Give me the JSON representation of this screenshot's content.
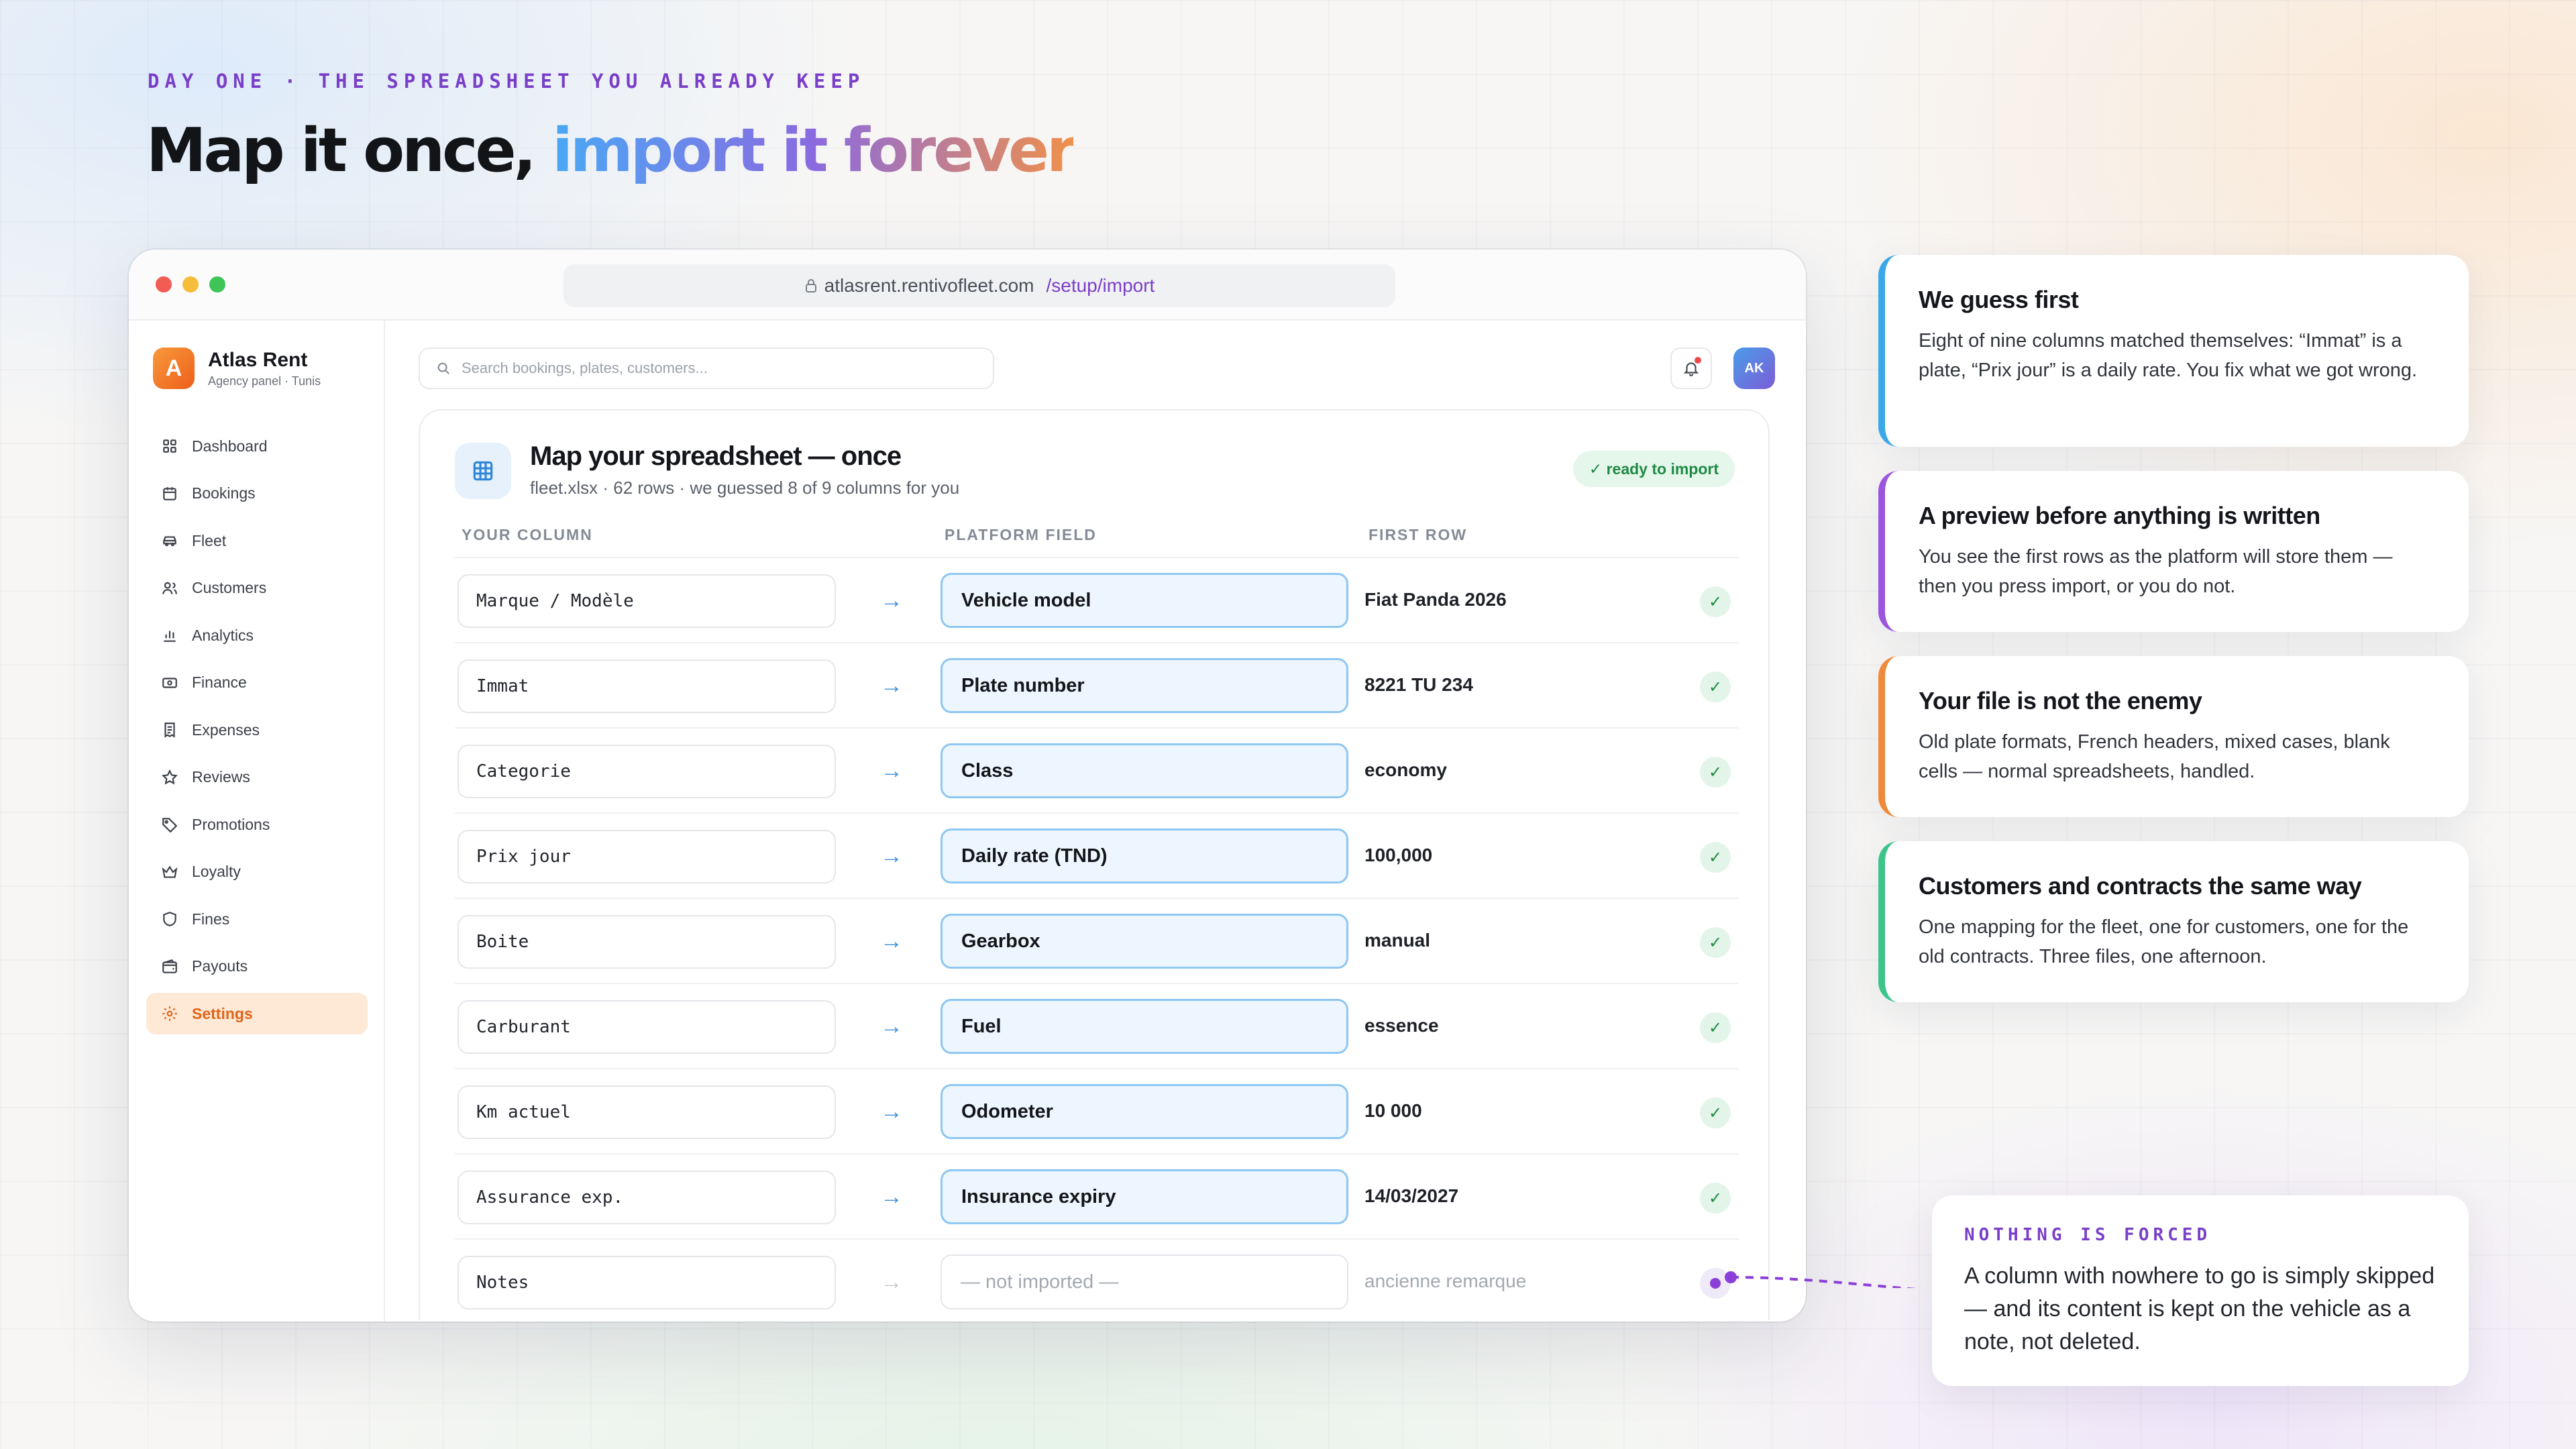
{
  "page": {
    "eyebrow": "DAY ONE · THE SPREADSHEET YOU ALREADY KEEP",
    "headline_plain": "Map it once, ",
    "headline_accent": "import it forever"
  },
  "browser": {
    "url_host": "atlasrent.rentivofleet.com",
    "url_path": "/setup/import",
    "lock_icon": "lock-icon"
  },
  "sidebar": {
    "brand_letter": "A",
    "brand_name": "Atlas Rent",
    "brand_sub": "Agency panel · Tunis",
    "items": [
      {
        "label": "Dashboard",
        "icon": "grid-icon"
      },
      {
        "label": "Bookings",
        "icon": "calendar-icon"
      },
      {
        "label": "Fleet",
        "icon": "car-icon"
      },
      {
        "label": "Customers",
        "icon": "users-icon"
      },
      {
        "label": "Analytics",
        "icon": "bar-chart-icon"
      },
      {
        "label": "Finance",
        "icon": "banknote-icon"
      },
      {
        "label": "Expenses",
        "icon": "receipt-icon"
      },
      {
        "label": "Reviews",
        "icon": "star-icon"
      },
      {
        "label": "Promotions",
        "icon": "tag-icon"
      },
      {
        "label": "Loyalty",
        "icon": "crown-icon"
      },
      {
        "label": "Fines",
        "icon": "shield-icon"
      },
      {
        "label": "Payouts",
        "icon": "wallet-icon"
      },
      {
        "label": "Settings",
        "icon": "gear-icon",
        "active": true
      }
    ]
  },
  "topbar": {
    "search_placeholder": "Search bookings, plates, customers...",
    "avatar_initials": "AK"
  },
  "mapping": {
    "title": "Map your spreadsheet — once",
    "subtitle": "fleet.xlsx · 62 rows · we guessed 8 of 9 columns for you",
    "status_badge": "✓ ready to import",
    "columns": [
      "YOUR COLUMN",
      "PLATFORM FIELD",
      "FIRST ROW"
    ],
    "rows": [
      {
        "source": "Marque / Modèle",
        "field": "Vehicle model",
        "first": "Fiat Panda 2026",
        "mapped": true
      },
      {
        "source": "Immat",
        "field": "Plate number",
        "first": "8221 TU 234",
        "mapped": true
      },
      {
        "source": "Categorie",
        "field": "Class",
        "first": "economy",
        "mapped": true
      },
      {
        "source": "Prix jour",
        "field": "Daily rate (TND)",
        "first": "100,000",
        "mapped": true
      },
      {
        "source": "Boite",
        "field": "Gearbox",
        "first": "manual",
        "mapped": true
      },
      {
        "source": "Carburant",
        "field": "Fuel",
        "first": "essence",
        "mapped": true
      },
      {
        "source": "Km actuel",
        "field": "Odometer",
        "first": "10 000",
        "mapped": true
      },
      {
        "source": "Assurance exp.",
        "field": "Insurance expiry",
        "first": "14/03/2027",
        "mapped": true
      },
      {
        "source": "Notes",
        "field": "— not imported —",
        "first": "ancienne remarque",
        "mapped": false
      }
    ]
  },
  "callouts": [
    {
      "title": "We guess first",
      "body": "Eight of nine columns matched themselves: “Immat” is a plate, “Prix jour” is a daily rate. You fix what we got wrong.",
      "color": "#3aa8e8"
    },
    {
      "title": "A preview before anything is written",
      "body": "You see the first rows as the platform will store them — then you press import, or you do not.",
      "color": "#9b55e0"
    },
    {
      "title": "Your file is not the enemy",
      "body": "Old plate formats, French headers, mixed cases, blank cells — normal spreadsheets, handled.",
      "color": "#f08a3a"
    },
    {
      "title": "Customers and contracts the same way",
      "body": "One mapping for the fleet, one for customers, one for the old contracts. Three files, one afternoon.",
      "color": "#3cc48a"
    }
  ],
  "note": {
    "eyebrow": "NOTHING IS FORCED",
    "body": "A column with nowhere to go is simply skipped — and its content is kept on the vehicle as a note, not deleted."
  },
  "colors": {
    "accent_purple": "#7a3fc8",
    "accent_orange": "#e0651a",
    "mapped_blue": "#8ec7f2",
    "ok_green": "#1f8a45"
  }
}
